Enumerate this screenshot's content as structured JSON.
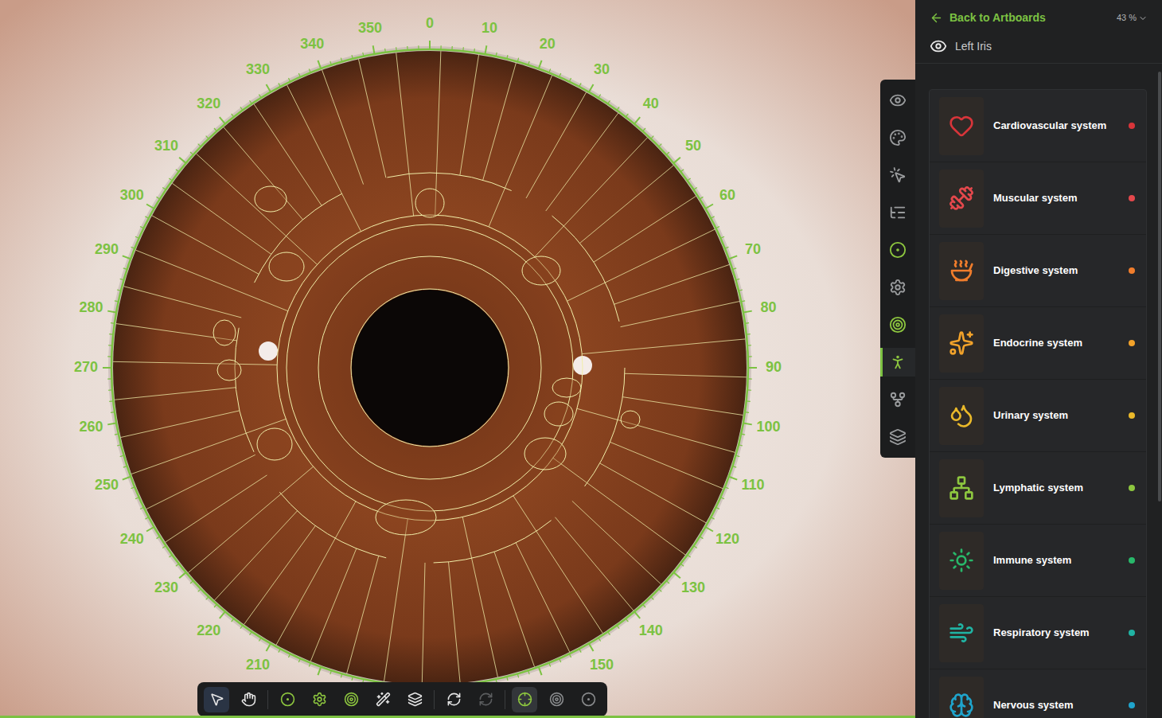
{
  "header": {
    "back": "Back to Artboards",
    "zoom": "43 %",
    "eye_label": "Left Iris"
  },
  "systems": [
    {
      "name": "Cardiovascular system",
      "color": "#d8353a"
    },
    {
      "name": "Muscular system",
      "color": "#e4484c"
    },
    {
      "name": "Digestive system",
      "color": "#f07d2c"
    },
    {
      "name": "Endocrine system",
      "color": "#f2a22a"
    },
    {
      "name": "Urinary system",
      "color": "#eab92a"
    },
    {
      "name": "Lymphatic system",
      "color": "#8dc63f"
    },
    {
      "name": "Immune system",
      "color": "#28b86a"
    },
    {
      "name": "Respiratory system",
      "color": "#20b3a3"
    },
    {
      "name": "Nervous system",
      "color": "#1fa4cc"
    }
  ],
  "side_tools": [
    {
      "selected": false
    },
    {
      "selected": false
    },
    {
      "selected": false
    },
    {
      "selected": false
    },
    {
      "selected": false
    },
    {
      "selected": false
    },
    {
      "selected": false
    },
    {
      "selected": true
    },
    {
      "selected": false
    },
    {
      "selected": false
    }
  ],
  "bottom_tools": [
    {
      "selected": true
    },
    {
      "selected": false
    },
    {
      "selected": false
    },
    {
      "selected": false
    },
    {
      "selected": false
    },
    {
      "selected": false
    },
    {
      "selected": false
    },
    {
      "selected": false
    },
    {
      "disabled": true
    },
    {
      "selected": true
    },
    {
      "selected": false
    },
    {
      "selected": false
    }
  ],
  "degree_labels": [
    "0",
    "10",
    "20",
    "30",
    "40",
    "50",
    "60",
    "70",
    "80",
    "90",
    "100",
    "110",
    "120",
    "130",
    "140",
    "150",
    "210",
    "220",
    "230",
    "240",
    "250",
    "260",
    "270",
    "280",
    "290",
    "300",
    "310",
    "320",
    "330",
    "340",
    "350"
  ]
}
